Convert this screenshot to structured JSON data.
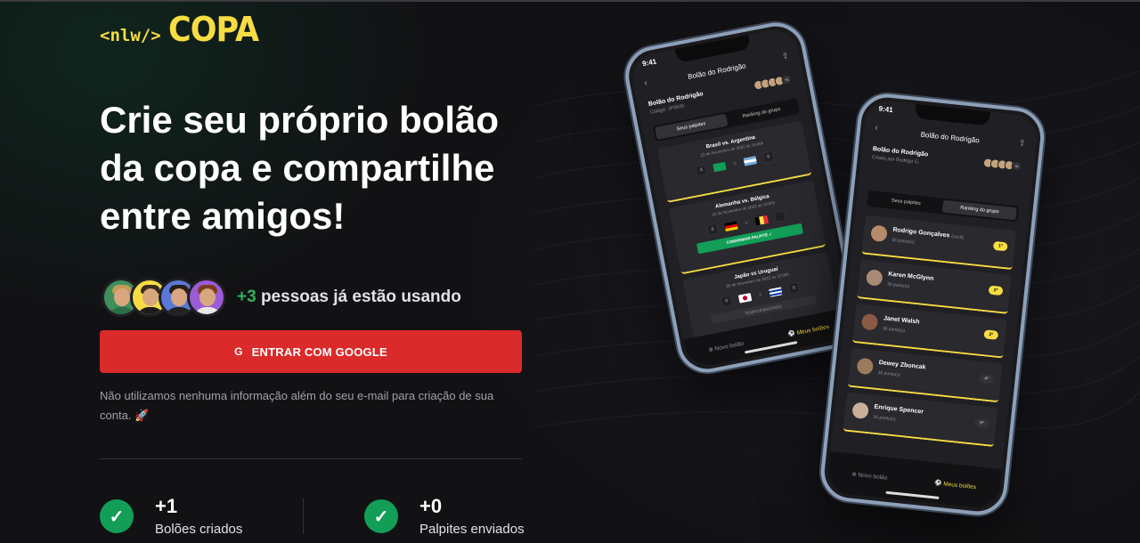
{
  "logo": {
    "nlw": "<nlw/>",
    "copa": "COPA"
  },
  "headline": "Crie seu próprio bolão da copa e compartilhe entre amigos!",
  "users": {
    "count": "+3",
    "text": " pessoas já estão usando"
  },
  "google_button": {
    "icon": "G",
    "label": "ENTRAR COM GOOGLE"
  },
  "disclaimer": "Não utilizamos nenhuma informação além do seu e-mail para criação de sua conta. 🚀",
  "stats": [
    {
      "value": "+1",
      "label": "Bolões criados"
    },
    {
      "value": "+0",
      "label": "Palpites enviados"
    }
  ],
  "colors": {
    "brand_yellow": "#F7DD43",
    "google_red": "#DB2A2A",
    "success_green": "#129E57",
    "background": "#121214"
  },
  "phone_left": {
    "time": "9:41",
    "header": "Bolão do Rodrigão",
    "pool_name": "Bolão do Rodrigão",
    "pool_code": "Código: JP3645",
    "tabs": [
      "Seus palpites",
      "Ranking do grupo"
    ],
    "games": [
      {
        "title": "Brasil vs. Argentina",
        "date": "22 de Novembro de 2022 às 16:00h",
        "left_score": "3",
        "right_score": "0"
      },
      {
        "title": "Alemanha vs. Bélgica",
        "date": "22 de Novembro de 2022 às 16:00h",
        "left_score": "0",
        "right_score": "",
        "confirm": "CONFIRMAR PALPITE ✓"
      },
      {
        "title": "Japão vs Uruguai",
        "date": "20 de Novembro de 2022 às 12:00h",
        "left_score": "0",
        "right_score": "0",
        "expired": "TEMPO ESGOTADO"
      }
    ],
    "bottom": {
      "new": "Novo bolão",
      "mine": "Meus bolões"
    },
    "more_avatars": "+6"
  },
  "phone_right": {
    "time": "9:41",
    "header": "Bolão do Rodrigão",
    "pool_name": "Bolão do Rodrigão",
    "pool_sub": "Criado por Rodrigo G.",
    "tabs": [
      "Seus palpites",
      "Ranking do grupo"
    ],
    "ranking": [
      {
        "name": "Rodrigo Gonçalves",
        "you": "(você)",
        "points": "36 ponto(s)",
        "pos": "1º"
      },
      {
        "name": "Karen McGlynn",
        "you": "",
        "points": "36 ponto(s)",
        "pos": "2º"
      },
      {
        "name": "Janet Walsh",
        "you": "",
        "points": "36 ponto(s)",
        "pos": "2º"
      },
      {
        "name": "Dewey Zboncak",
        "you": "",
        "points": "36 ponto(s)",
        "pos": "4º"
      },
      {
        "name": "Enrique Spencer",
        "you": "",
        "points": "36 ponto(s)",
        "pos": "5º"
      }
    ],
    "bottom": {
      "new": "Novo bolão",
      "mine": "Meus bolões"
    },
    "more_avatars": "+6"
  }
}
